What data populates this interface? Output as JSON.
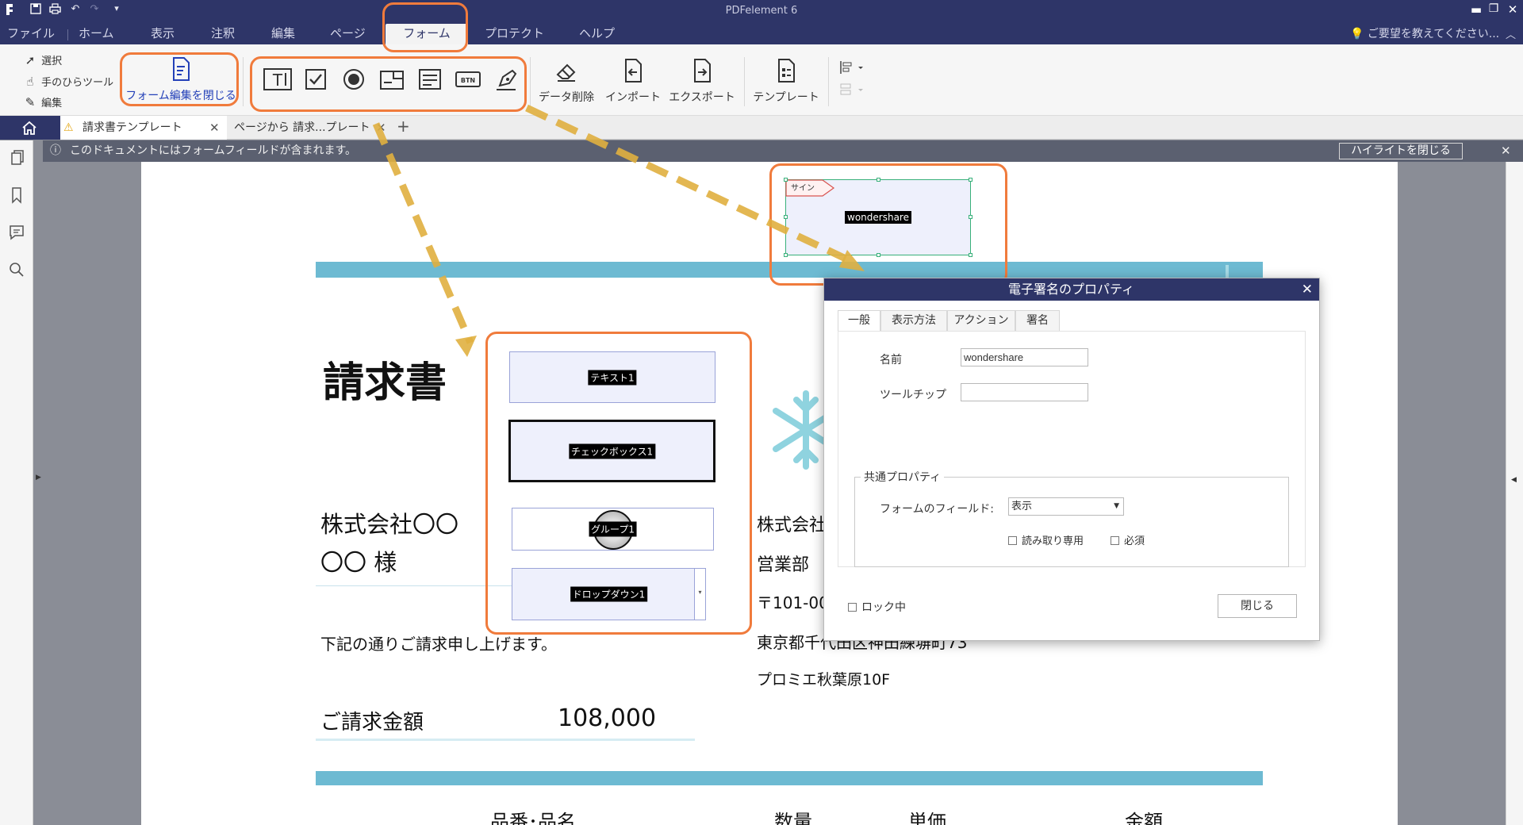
{
  "window": {
    "title": "PDFelement 6",
    "quick_access": [
      "app-icon",
      "save-icon",
      "print-icon",
      "undo-icon",
      "redo-icon",
      "customize-icon"
    ],
    "controls": [
      "minimize-icon",
      "maximize-icon",
      "close-icon"
    ]
  },
  "menu": {
    "items": [
      {
        "label": "ファイル"
      },
      {
        "label": "ホーム"
      },
      {
        "label": "表示"
      },
      {
        "label": "注釈"
      },
      {
        "label": "編集"
      },
      {
        "label": "ページ"
      },
      {
        "label": "フォーム",
        "active": true
      },
      {
        "label": "プロテクト"
      },
      {
        "label": "ヘルプ"
      }
    ],
    "feedback": "ご要望を教えてください..."
  },
  "ribbon": {
    "select": "選択",
    "hand": "手のひらツール",
    "edit": "編集",
    "close_form_edit": "フォーム編集を閉じる",
    "form_tools": [
      "text-field-icon",
      "checkbox-icon",
      "radio-button-icon",
      "combo-box-icon",
      "list-box-icon",
      "button-icon",
      "signature-field-icon"
    ],
    "clear_data": "データ削除",
    "import": "インポート",
    "export": "エクスポート",
    "template": "テンプレート"
  },
  "tabs": {
    "doc1": "請求書テンプレート",
    "doc2": "ページから 請求...プレート",
    "add": "+"
  },
  "notice": {
    "text": "このドキュメントにはフォームフィールドが含まれます。",
    "button": "ハイライトを閉じる"
  },
  "document": {
    "title": "請求書",
    "client_company": "株式会社〇〇",
    "client_name": "〇〇 様",
    "vendor_company": "株式会社",
    "vendor_dept": "営業部",
    "vendor_zip": "〒101-00",
    "intro": "下記の通りご請求申し上げます。",
    "vendor_address": "東京都千代田区神田練塀町73",
    "vendor_building": "プロミエ秋葉原10F",
    "amount_label": "ご請求金額",
    "amount_value": "108,000",
    "columns": [
      "品番･品名",
      "数量",
      "単価",
      "金額"
    ],
    "decoration": "snowflake-icon"
  },
  "fields": {
    "text": "テキスト1",
    "checkbox": "チェックボックス1",
    "radio": "グループ1",
    "dropdown": "ドロップダウン1",
    "signature": "wondershare",
    "signature_tag": "サイン"
  },
  "dialog": {
    "title": "電子署名のプロパティ",
    "tabs": [
      "一般",
      "表示方法",
      "アクション",
      "署名"
    ],
    "name_label": "名前",
    "name_value": "wondershare",
    "tooltip_label": "ツールチップ",
    "tooltip_value": "",
    "common_group": "共通プロパティ",
    "visibility_label": "フォームのフィールド:",
    "visibility_value": "表示",
    "readonly": "読み取り専用",
    "required": "必須",
    "locked": "ロック中",
    "close": "閉じる"
  },
  "colors": {
    "title_bar": "#2e3568",
    "accent_band": "#6dbad2",
    "callout": "#f07b3c",
    "arrow": "#e0b040"
  }
}
